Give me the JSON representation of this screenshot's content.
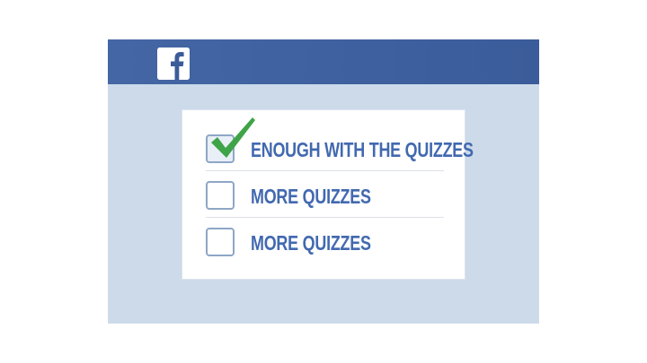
{
  "header": {
    "logo_icon": "facebook-f-icon",
    "brand_color": "#3b5c9a"
  },
  "quiz_options": [
    {
      "label": "ENOUGH WITH THE QUIZZES",
      "checked": true
    },
    {
      "label": "MORE QUIZZES",
      "checked": false
    },
    {
      "label": "MORE QUIZZES",
      "checked": false
    }
  ],
  "colors": {
    "background": "#cddaea",
    "label_text": "#4269b0",
    "checkmark": "#3ea447",
    "checkbox_border": "#8ea6c6"
  }
}
